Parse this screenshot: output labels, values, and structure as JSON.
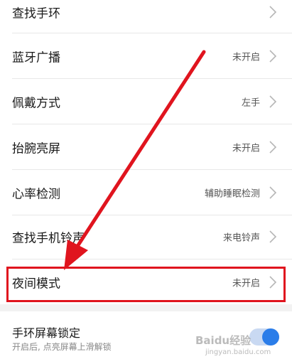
{
  "settings": {
    "items": [
      {
        "label": "查找手环",
        "value": ""
      },
      {
        "label": "蓝牙广播",
        "value": "未开启"
      },
      {
        "label": "佩戴方式",
        "value": "左手"
      },
      {
        "label": "抬腕亮屏",
        "value": "未开启"
      },
      {
        "label": "心率检测",
        "value": "辅助睡眠检测"
      },
      {
        "label": "查找手机铃声",
        "value": "来电铃声"
      },
      {
        "label": "夜间模式",
        "value": "未开启"
      }
    ],
    "lock": {
      "label": "手环屏幕锁定",
      "subtitle": "开启后, 点亮屏幕上滑解锁",
      "enabled": true
    }
  },
  "annotation": {
    "highlight_color": "#e0141e",
    "highlighted_item": "夜间模式"
  },
  "watermark": {
    "text": "Baidu经验",
    "sub": "jingyan.baidu.com"
  },
  "colors": {
    "accent": "#2b7de9",
    "annotation_red": "#e0141e"
  }
}
